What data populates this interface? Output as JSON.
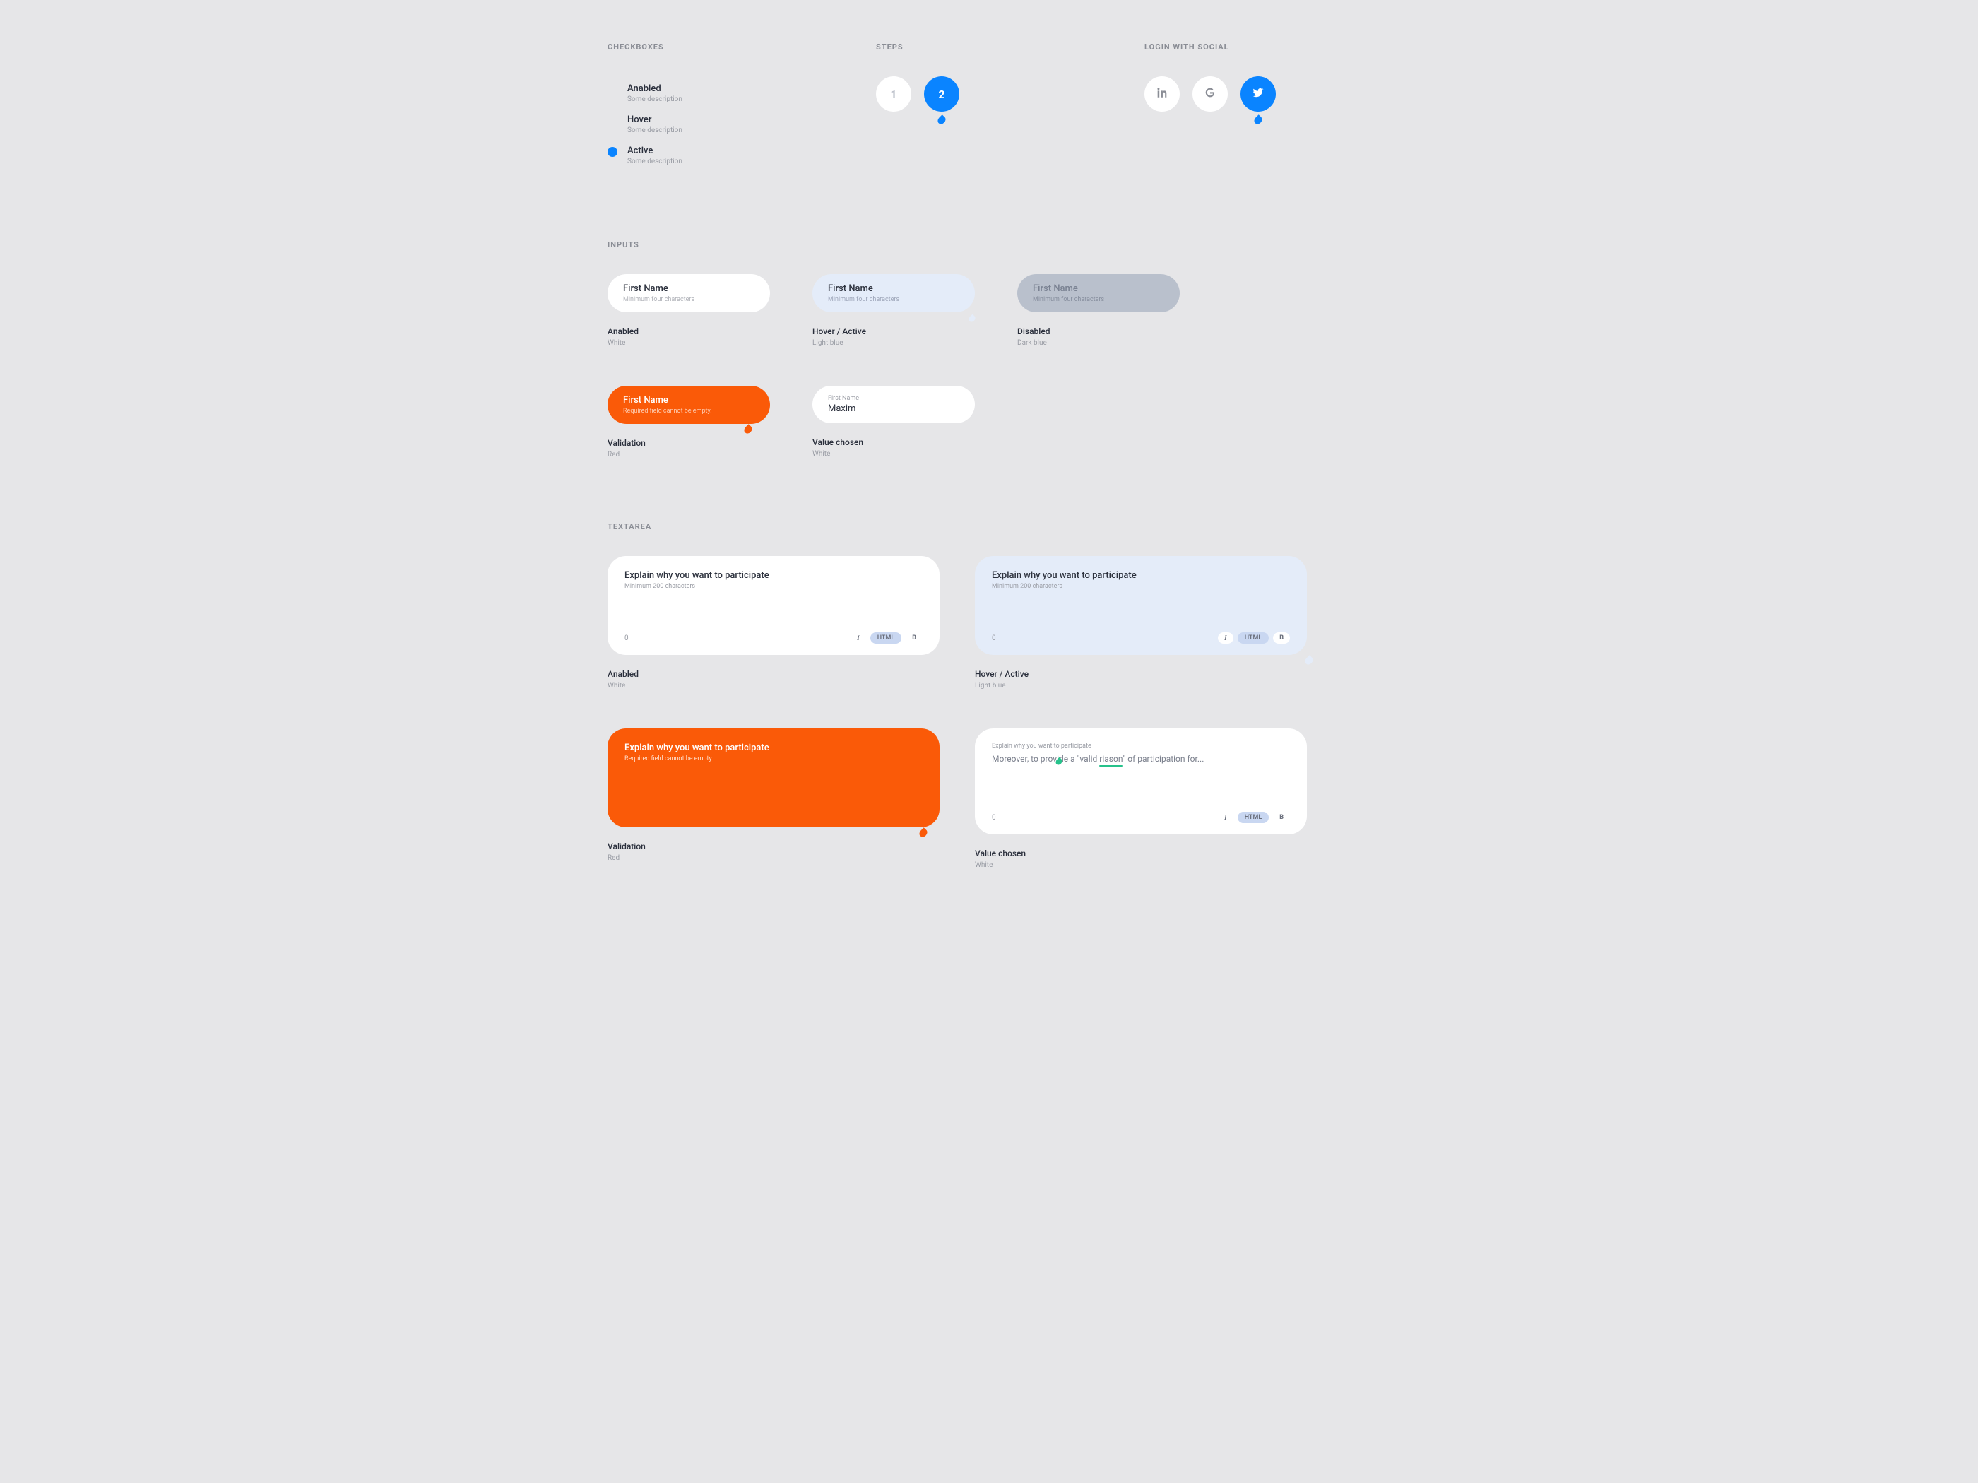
{
  "colors": {
    "accent_blue": "#0a84ff",
    "accent_orange": "#fa5a08",
    "bg": "#e6e6e8",
    "input_light": "#e4ecf9",
    "input_disabled": "#b9c0cc",
    "spell_green": "#27c28b"
  },
  "sections": {
    "checkboxes": {
      "title": "CHECKBOXES",
      "items": [
        {
          "label": "Anabled",
          "desc": "Some description",
          "active": false
        },
        {
          "label": "Hover",
          "desc": "Some description",
          "active": false
        },
        {
          "label": "Active",
          "desc": "Some description",
          "active": true
        }
      ]
    },
    "steps": {
      "title": "STEPS",
      "items": [
        {
          "label": "1",
          "style": "white",
          "active": false
        },
        {
          "label": "2",
          "style": "blue",
          "active": true
        }
      ]
    },
    "social": {
      "title": "LOGIN WITH SOCIAL",
      "items": [
        {
          "name": "linkedin",
          "style": "white",
          "active": false
        },
        {
          "name": "google",
          "style": "white",
          "active": false
        },
        {
          "name": "twitter",
          "style": "blue",
          "active": true
        }
      ]
    },
    "inputs": {
      "title": "INPUTS",
      "cells": {
        "enabled": {
          "label": "First Name",
          "hint": "Minimum four characters",
          "state_title": "Anabled",
          "state_desc": "White"
        },
        "hover": {
          "label": "First Name",
          "hint": "Minimum four characters",
          "state_title": "Hover / Active",
          "state_desc": "Light blue"
        },
        "disabled": {
          "label": "First Name",
          "hint": "Minimum four characters",
          "state_title": "Disabled",
          "state_desc": "Dark blue"
        },
        "validation": {
          "label": "First Name",
          "hint": "Required field cannot be empty.",
          "state_title": "Validation",
          "state_desc": "Red"
        },
        "value": {
          "mini_label": "First Name",
          "value": "Maxim",
          "state_title": "Value chosen",
          "state_desc": "White"
        }
      }
    },
    "textarea": {
      "title": "TEXTAREA",
      "counter": "0",
      "format": {
        "italic": "I",
        "html": "HTML",
        "bold": "B"
      },
      "cells": {
        "enabled": {
          "label": "Explain why you want to participate",
          "hint": "Minimum 200 characters",
          "state_title": "Anabled",
          "state_desc": "White"
        },
        "hover": {
          "label": "Explain why you want to participate",
          "hint": "Minimum 200 characters",
          "state_title": "Hover / Active",
          "state_desc": "Light blue"
        },
        "validation": {
          "label": "Explain why you want to participate",
          "hint": "Required field cannot be empty.",
          "state_title": "Validation",
          "state_desc": "Red"
        },
        "value": {
          "mini_label": "Explain why you want to participate",
          "body_before": "Moreover, to provide a \"valid ",
          "body_underlined": "riason",
          "body_after": "\" of participation for...",
          "state_title": "Value chosen",
          "state_desc": "White"
        }
      }
    }
  }
}
